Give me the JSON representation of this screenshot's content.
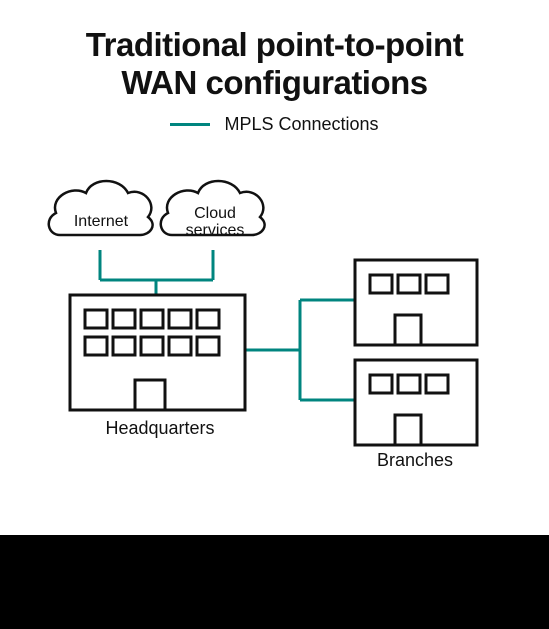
{
  "title_line1": "Traditional point-to-point",
  "title_line2": "WAN configurations",
  "legend_label": "MPLS Connections",
  "nodes": {
    "internet": "Internet",
    "cloud_services_l1": "Cloud",
    "cloud_services_l2": "services",
    "headquarters": "Headquarters",
    "branches": "Branches"
  },
  "colors": {
    "connection": "#00857f",
    "outline": "#111111"
  }
}
